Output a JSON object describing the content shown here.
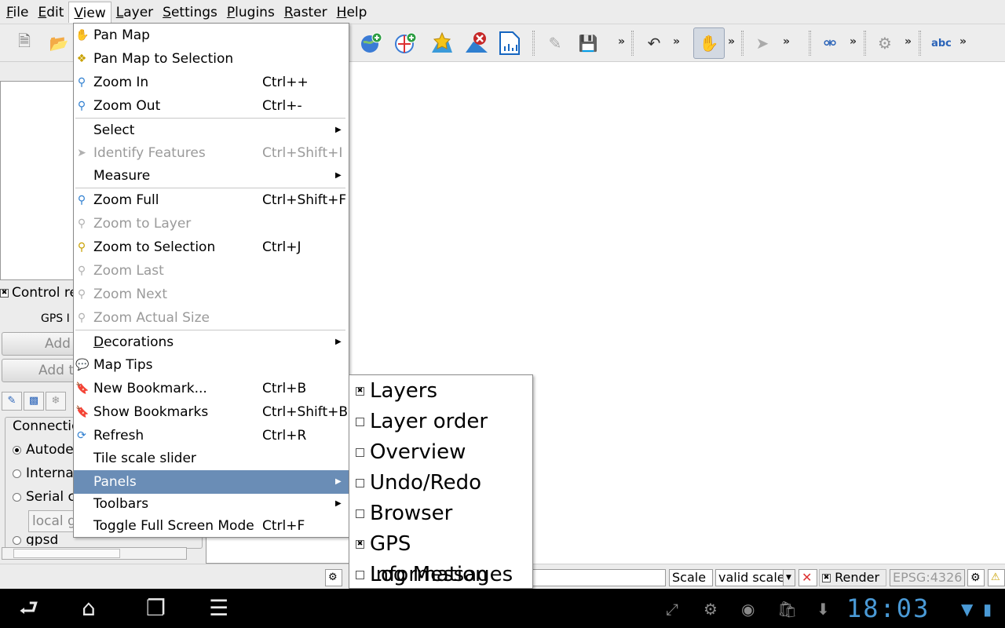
{
  "menubar": {
    "items": [
      {
        "label": "File",
        "u": "F",
        "rest": "ile"
      },
      {
        "label": "Edit",
        "u": "E",
        "rest": "dit"
      },
      {
        "label": "View",
        "u": "V",
        "rest": "iew"
      },
      {
        "label": "Layer",
        "u": "L",
        "rest": "ayer"
      },
      {
        "label": "Settings",
        "u": "S",
        "rest": "ettings"
      },
      {
        "label": "Plugins",
        "u": "P",
        "rest": "lugins"
      },
      {
        "label": "Raster",
        "u": "R",
        "rest": "aster"
      },
      {
        "label": "Help",
        "u": "H",
        "rest": "elp"
      }
    ]
  },
  "toolbar": {
    "more": "»"
  },
  "view_menu": {
    "pan_map": "Pan Map",
    "pan_map_selection": "Pan Map to Selection",
    "zoom_in": "Zoom In",
    "zoom_in_sc": "Ctrl++",
    "zoom_out": "Zoom Out",
    "zoom_out_sc": "Ctrl+-",
    "select": "Select",
    "identify": "Identify Features",
    "identify_sc": "Ctrl+Shift+I",
    "measure": "Measure",
    "zoom_full": "Zoom Full",
    "zoom_full_sc": "Ctrl+Shift+F",
    "zoom_layer": "Zoom to Layer",
    "zoom_selection": "Zoom to Selection",
    "zoom_selection_sc": "Ctrl+J",
    "zoom_last": "Zoom Last",
    "zoom_next": "Zoom Next",
    "zoom_actual": "Zoom Actual Size",
    "decorations_u": "D",
    "decorations_rest": "ecorations",
    "map_tips": "Map Tips",
    "new_bookmark": "New Bookmark...",
    "new_bookmark_sc": "Ctrl+B",
    "show_bookmarks": "Show Bookmarks",
    "show_bookmarks_sc": "Ctrl+Shift+B",
    "refresh": "Refresh",
    "refresh_sc": "Ctrl+R",
    "tile_scale": "Tile scale slider",
    "panels": "Panels",
    "toolbars": "Toolbars",
    "fullscreen": "Toggle Full Screen Mode",
    "fullscreen_sc": "Ctrl+F"
  },
  "panels_menu": [
    {
      "label": "Layers",
      "checked": true
    },
    {
      "label": "Layer order",
      "checked": false
    },
    {
      "label": "Overview",
      "checked": false
    },
    {
      "label": "Undo/Redo",
      "checked": false
    },
    {
      "label": "Browser",
      "checked": false
    },
    {
      "label": "GPS Information",
      "checked": true
    },
    {
      "label": "Log Messages",
      "checked": false
    }
  ],
  "left_panel": {
    "control_rendering": "Control re",
    "gps_title": "GPS I",
    "add_btn1": "Add",
    "add_btn2": "Add t",
    "connection_legend": "Connectic",
    "radio_autodetect": "Autode",
    "radio_internal": "Interna",
    "radio_serial": "Serial c",
    "local_input": "local g",
    "radio_gpsd": "gpsd"
  },
  "statusbar": {
    "scale_label": "Scale",
    "scale_value": "valid scale",
    "render_label": "Render",
    "crs": "EPSG:4326",
    "check_mark": "✖"
  },
  "system": {
    "clock": "18:03"
  },
  "colors": {
    "menu_highlight": "#6a8db6",
    "clock": "#4a9ad6",
    "toolbar_icon": "#2a63b8"
  }
}
